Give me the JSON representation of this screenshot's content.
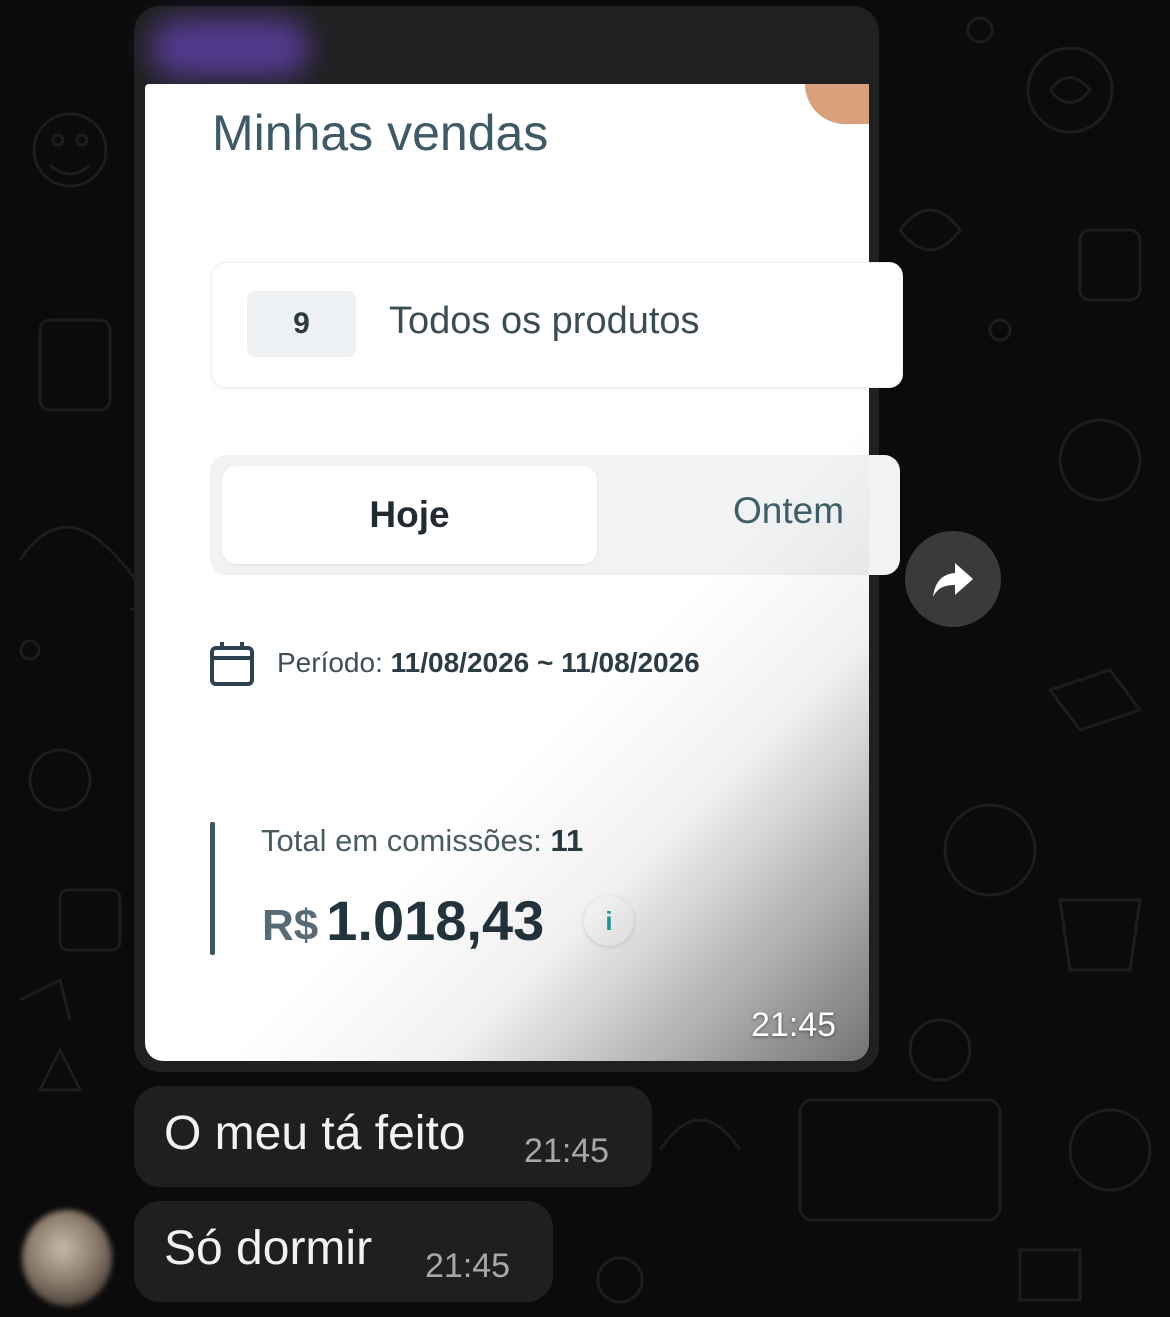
{
  "screenshot": {
    "title": "Minhas vendas",
    "product_filter": {
      "count": "9",
      "label": "Todos os produtos"
    },
    "tabs": [
      {
        "label": "Hoje"
      },
      {
        "label": "Ontem"
      }
    ],
    "period": {
      "label": "Período:",
      "value": "11/08/2026 ~ 11/08/2026"
    },
    "commissions": {
      "label": "Total em comissões:",
      "count": "11",
      "currency": "R$",
      "amount": "1.018,43",
      "info": "i"
    }
  },
  "messages": [
    {
      "time": "21:45"
    },
    {
      "text": "O meu tá feito",
      "time": "21:45"
    },
    {
      "text": "Só dormir",
      "time": "21:45"
    }
  ],
  "colors": {
    "background": "#0b0b0b",
    "bubble": "#1f1f1f",
    "title": "#3d5a66",
    "accent_info": "#1aa6a0"
  }
}
